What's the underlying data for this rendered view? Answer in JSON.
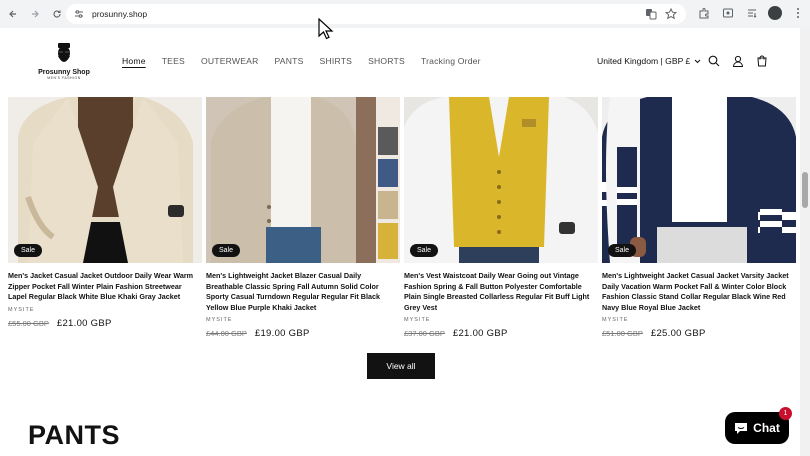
{
  "browser": {
    "url": "prosunny.shop",
    "icons": [
      "back-icon",
      "forward-icon",
      "reload-icon",
      "site-settings-icon",
      "translate-icon",
      "bookmark-star-icon",
      "extensions-icon",
      "media-icon",
      "downloads-icon",
      "profile-avatar",
      "menu-dots-icon"
    ]
  },
  "header": {
    "logo_name": "Prosunny Shop",
    "logo_tag": "MEN'S FASHION",
    "nav": [
      "Home",
      "TEES",
      "OUTERWEAR",
      "PANTS",
      "SHIRTS",
      "SHORTS",
      "Tracking Order"
    ],
    "active_nav": "Home",
    "locale": "United Kingdom | GBP £"
  },
  "products": [
    {
      "title": "Men's Jacket Casual Jacket Outdoor Daily Wear Warm Zipper Pocket Fall Winter Plain Fashion Streetwear Lapel Regular Black White Blue Khaki Gray Jacket",
      "vendor": "MYSITE",
      "old_price": "£55.00 GBP",
      "price": "£21.00 GBP",
      "badge": "Sale"
    },
    {
      "title": "Men's Lightweight Jacket Blazer Casual Daily Breathable Classic Spring Fall Autumn Solid Color Sporty Casual Turndown Regular Regular Fit Black Yellow Blue Purple Khaki Jacket",
      "vendor": "MYSITE",
      "old_price": "£44.00 GBP",
      "price": "£19.00 GBP",
      "badge": "Sale"
    },
    {
      "title": "Men's Vest Waistcoat Daily Wear Going out Vintage Fashion Spring & Fall Button Polyester Comfortable Plain Single Breasted Collarless Regular Fit Buff Light Grey Vest",
      "vendor": "MYSITE",
      "old_price": "£37.00 GBP",
      "price": "£21.00 GBP",
      "badge": "Sale"
    },
    {
      "title": "Men's Lightweight Jacket Casual Jacket Varsity Jacket Daily Vacation Warm Pocket Fall & Winter Color Block Fashion Classic Stand Collar Regular Black Wine Red Navy Blue Royal Blue Jacket",
      "vendor": "MYSITE",
      "old_price": "£51.00 GBP",
      "price": "£25.00 GBP",
      "badge": "Sale"
    }
  ],
  "view_all_label": "View all",
  "next_section_title": "PANTS",
  "chat": {
    "label": "Chat",
    "badge": "1"
  }
}
